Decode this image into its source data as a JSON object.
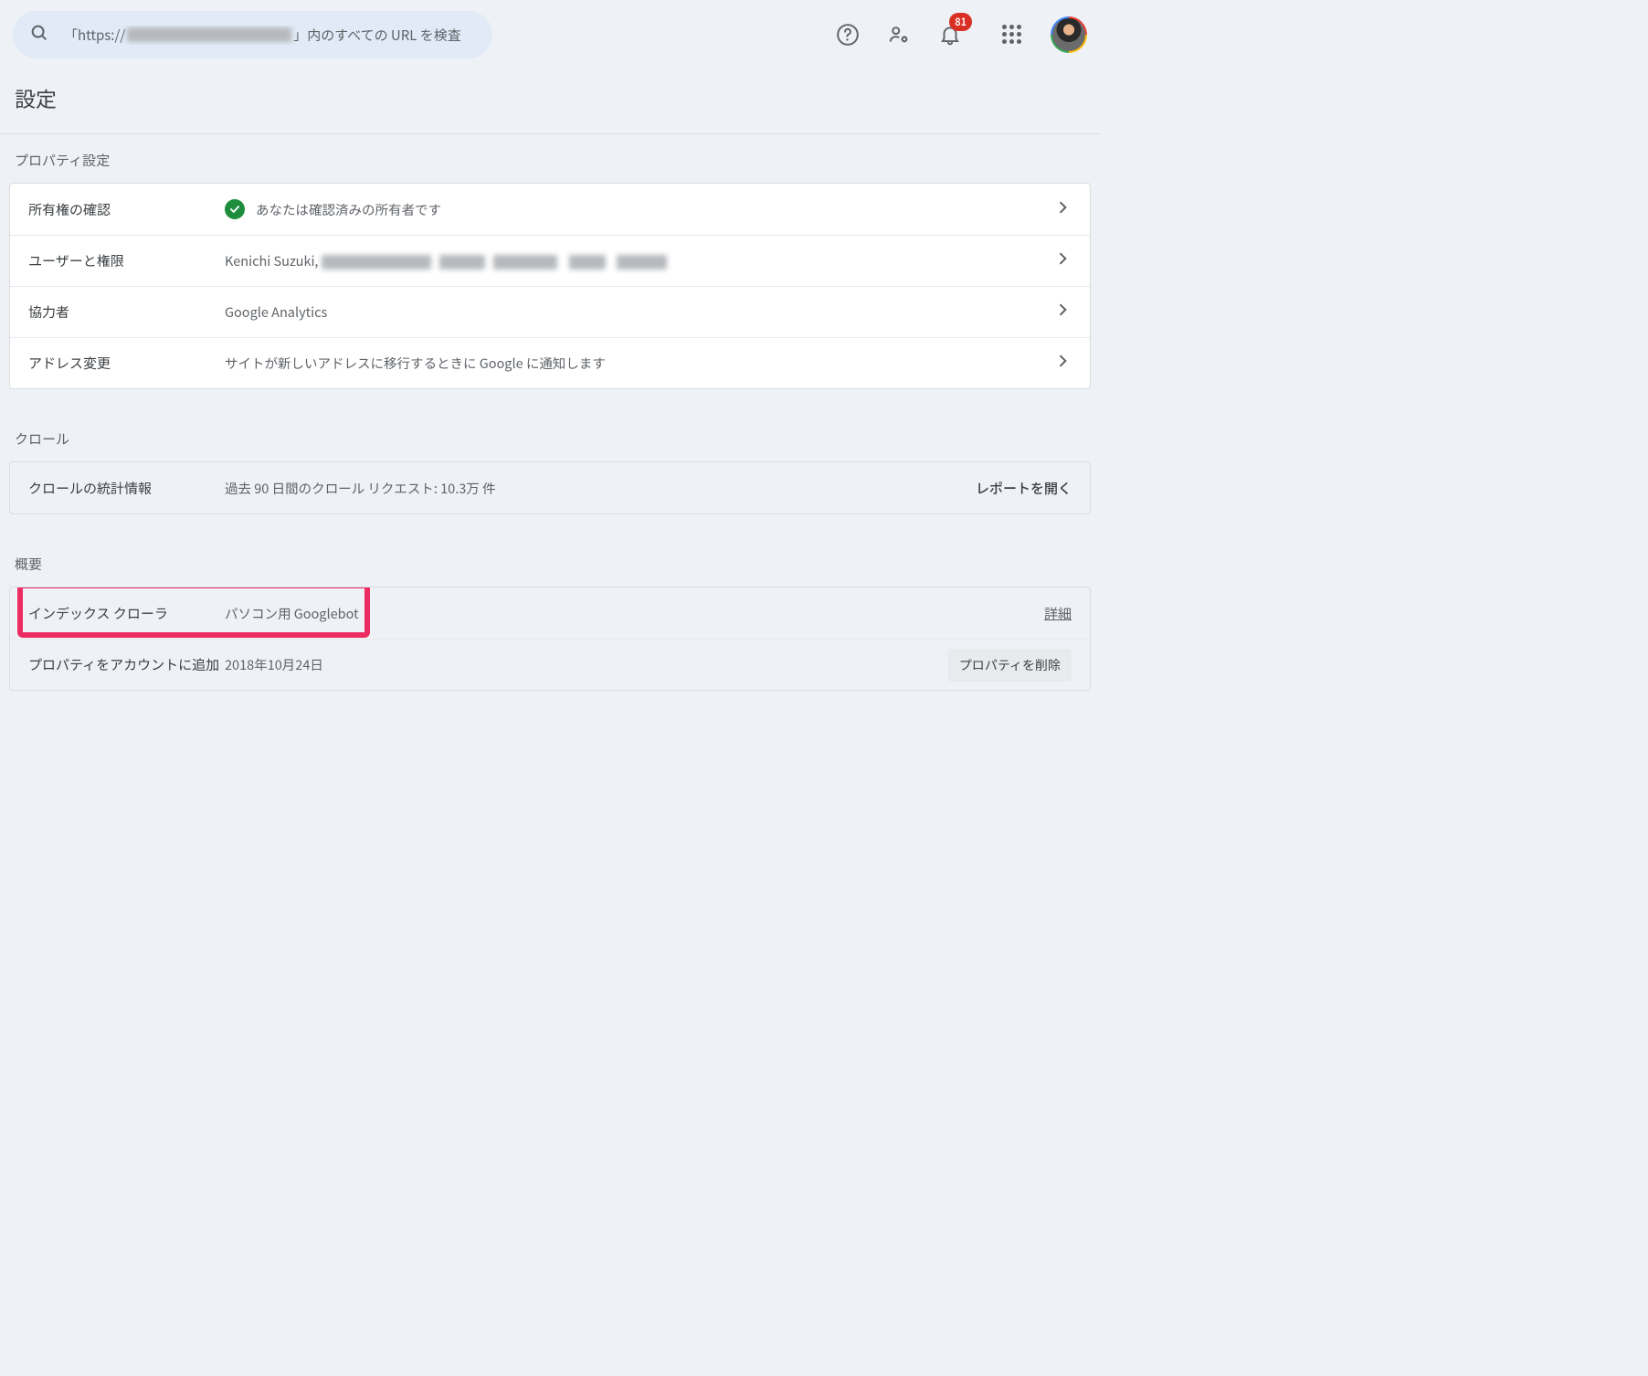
{
  "header": {
    "search_prefix": "「https://",
    "search_suffix": "」内のすべての URL を検査",
    "notifications_count": "81"
  },
  "page_title": "設定",
  "sections": {
    "property": {
      "label": "プロパティ設定",
      "rows": {
        "ownership": {
          "label": "所有権の確認",
          "value": "あなたは確認済みの所有者です"
        },
        "users": {
          "label": "ユーザーと権限",
          "value_prefix": "Kenichi Suzuki, "
        },
        "collaborators": {
          "label": "協力者",
          "value": "Google Analytics"
        },
        "address": {
          "label": "アドレス変更",
          "value": "サイトが新しいアドレスに移行するときに Google に通知します"
        }
      }
    },
    "crawl": {
      "label": "クロール",
      "row": {
        "label": "クロールの統計情報",
        "value": "過去 90 日間のクロール リクエスト: 10.3万 件",
        "action": "レポートを開く"
      }
    },
    "summary": {
      "label": "概要",
      "rows": {
        "crawler": {
          "label": "インデックス クローラ",
          "value": "パソコン用 Googlebot",
          "action": "詳細"
        },
        "added": {
          "label": "プロパティをアカウントに追加",
          "value": "2018年10月24日",
          "action": "プロパティを削除"
        }
      }
    }
  }
}
